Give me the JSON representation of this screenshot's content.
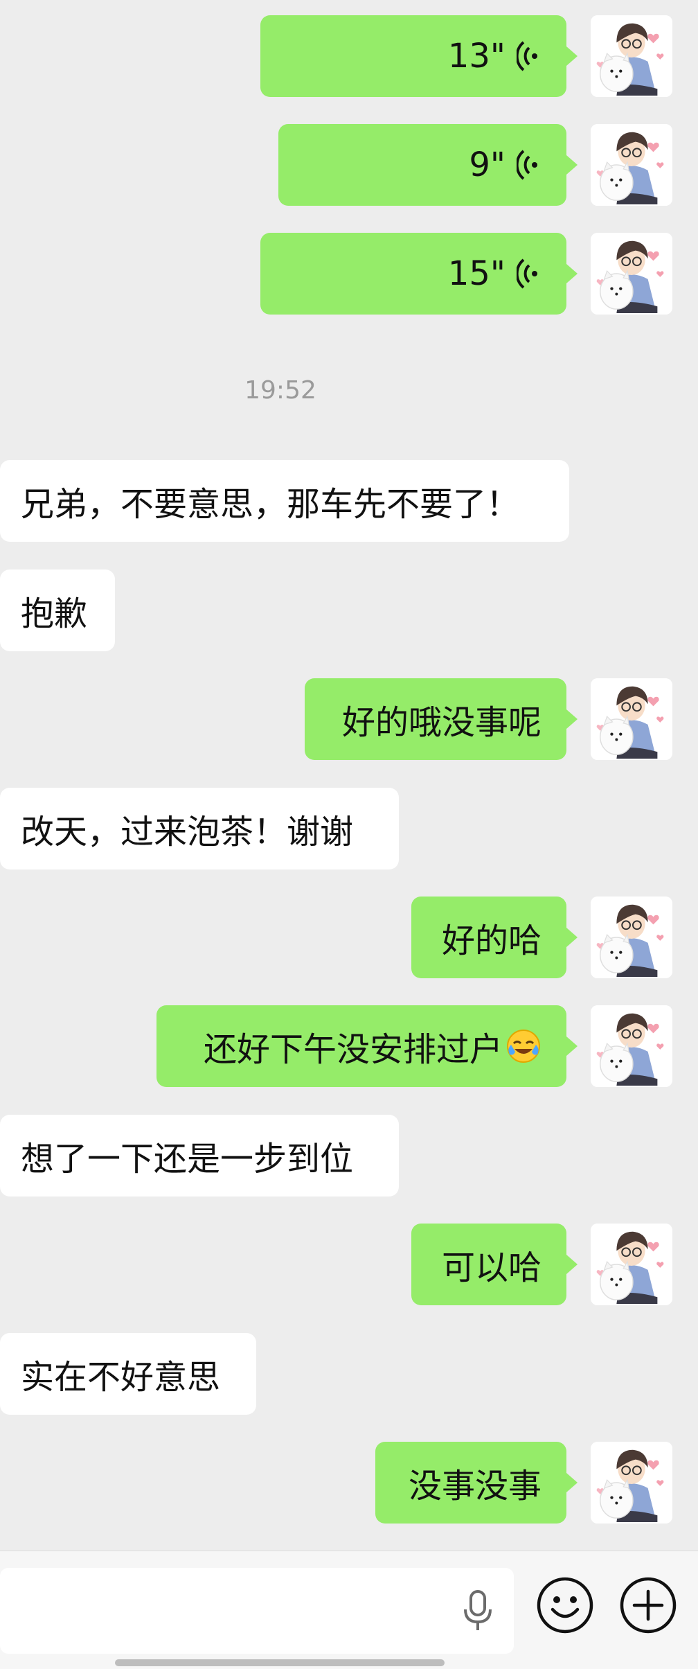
{
  "time_separator": "19:52",
  "voice_messages": [
    {
      "duration": "13\""
    },
    {
      "duration": "9\""
    },
    {
      "duration": "15\""
    }
  ],
  "messages": [
    {
      "text": "兄弟，不要意思，那车先不要了！"
    },
    {
      "text": "抱歉"
    },
    {
      "text": "好的哦没事呢"
    },
    {
      "text": "改天，过来泡茶！谢谢"
    },
    {
      "text": "好的哈"
    },
    {
      "text": "还好下午没安排过户",
      "emoji": "crying-laughing-emoji"
    },
    {
      "text": "想了一下还是一步到位"
    },
    {
      "text": "可以哈"
    },
    {
      "text": "实在不好意思"
    },
    {
      "text": "没事没事"
    }
  ],
  "colors": {
    "background": "#ededed",
    "outgoing_bubble": "#95ec69",
    "incoming_bubble": "#ffffff",
    "timestamp": "#9a9a9a"
  },
  "icons": {
    "voice": "voice-wave-icon",
    "mic": "microphone-icon",
    "emoji": "smiley-face-icon",
    "plus": "plus-icon"
  }
}
